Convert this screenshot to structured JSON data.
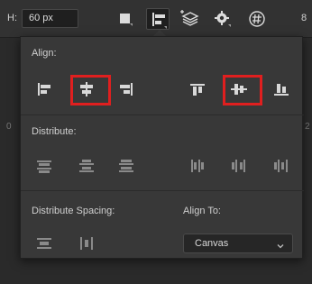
{
  "toolbar": {
    "h_label": "H:",
    "h_value": "60 px",
    "edge_text": "8"
  },
  "ruler": {
    "left_number": "0",
    "right_number": "2"
  },
  "align_panel": {
    "align_label": "Align:",
    "distribute_label": "Distribute:",
    "distribute_spacing_label": "Distribute Spacing:",
    "align_to_label": "Align To:",
    "align_to_value": "Canvas"
  },
  "colors": {
    "panel_bg": "#383838",
    "highlight": "#e01f1f",
    "icon": "#d8d8d8",
    "icon_dim": "#8a8a8a"
  }
}
